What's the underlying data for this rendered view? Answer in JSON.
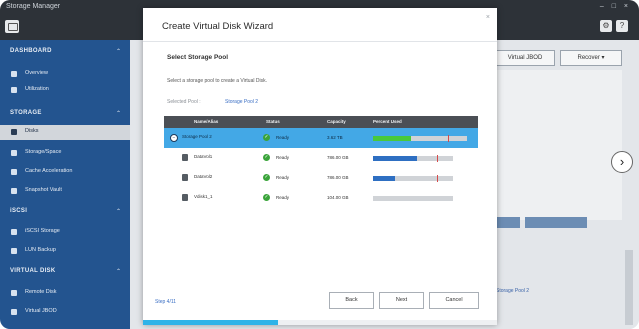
{
  "app": {
    "title": "Storage Manager"
  },
  "sidebar": {
    "sections": [
      {
        "label": "DASHBOARD",
        "items": [
          {
            "label": "Overview"
          },
          {
            "label": "Utilization"
          }
        ]
      },
      {
        "label": "STORAGE",
        "items": [
          {
            "label": "Disks",
            "active": true
          },
          {
            "label": "Storage/Space"
          },
          {
            "label": "Cache Acceleration"
          },
          {
            "label": "Snapshot Vault"
          }
        ]
      },
      {
        "label": "iSCSI",
        "items": [
          {
            "label": "iSCSI Storage"
          },
          {
            "label": "LUN Backup"
          }
        ]
      },
      {
        "label": "VIRTUAL DISK",
        "items": [
          {
            "label": "Remote Disk"
          },
          {
            "label": "Virtual JBOD"
          }
        ]
      }
    ]
  },
  "background": {
    "buttons": [
      "Virtual JBOD",
      "Recover ▾"
    ],
    "link": "Storage Pool 2"
  },
  "wizard": {
    "title": "Create Virtual Disk Wizard",
    "close": "×",
    "subheading": "Select Storage Pool",
    "instruction": "Select a storage pool to create a Virtual Disk.",
    "selected_label": "Selected Pool :",
    "selected_value": "Storage Pool 2",
    "columns": [
      "Name/Alias",
      "Status",
      "Capacity",
      "Percent Used"
    ],
    "rows": [
      {
        "name": "Storage Pool 2",
        "status": "Ready",
        "capacity": "3.62 TB",
        "selected": true,
        "used": 0.4,
        "threshold": 0.8
      },
      {
        "name": "DataVol1",
        "status": "Ready",
        "capacity": "786.00 GB",
        "selected": false,
        "used": 0.55,
        "threshold": 0.8
      },
      {
        "name": "DataVol2",
        "status": "Ready",
        "capacity": "786.00 GB",
        "selected": false,
        "used": 0.28,
        "threshold": 0.8
      },
      {
        "name": "Vdisk1_1",
        "status": "Ready",
        "capacity": "104.00 GB",
        "selected": false,
        "used": 0.0,
        "threshold": 0.8
      }
    ],
    "step": "Step 4/11",
    "buttons": {
      "back": "Back",
      "next": "Next",
      "cancel": "Cancel"
    },
    "progress": 0.38
  },
  "colors": {
    "accent": "#43a8e6",
    "sidebar": "#23548f",
    "usage_selected": "#48c93b",
    "usage_other": "#2e6fc2",
    "threshold": "#d64a4a"
  }
}
